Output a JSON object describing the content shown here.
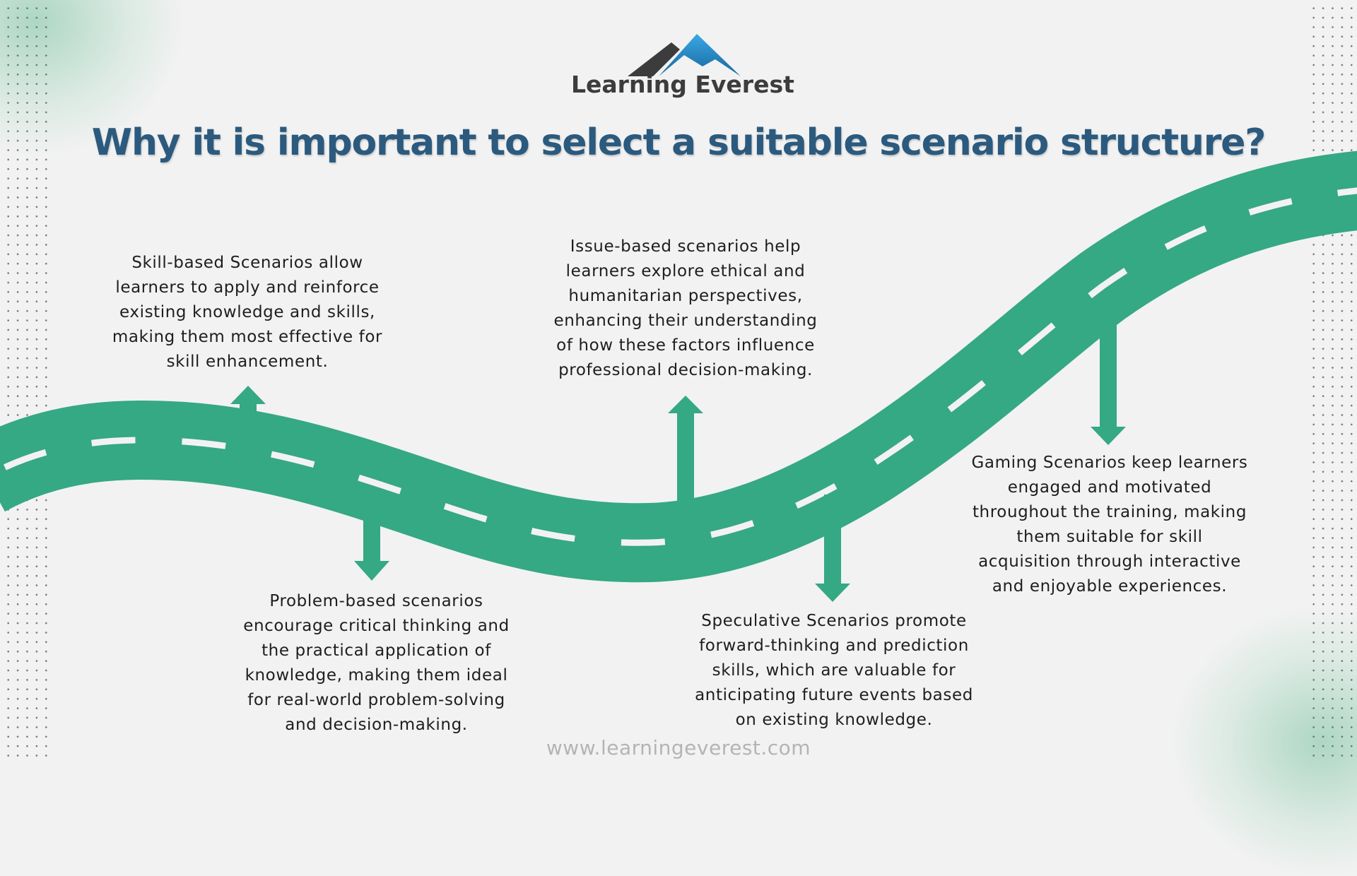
{
  "brand": {
    "name": "Learning Everest",
    "website": "www.learningeverest.com"
  },
  "title": "Why it is important to select a suitable scenario structure?",
  "colors": {
    "road": "#35a884",
    "title": "#2b5a7e",
    "body_text": "#1e1e1e",
    "logo_dark": "#3c3c3c",
    "logo_blue": "#1f8fd1",
    "footer": "#b4b4b4",
    "background": "#f2f2f2"
  },
  "scenarios": [
    {
      "id": "skill",
      "arrow_direction": "up",
      "lines": [
        "Skill-based Scenarios allow",
        "learners to apply and reinforce",
        "existing knowledge and skills,",
        "making them most effective for",
        "skill enhancement."
      ]
    },
    {
      "id": "problem",
      "arrow_direction": "down",
      "lines": [
        "Problem-based scenarios",
        "encourage critical thinking and",
        "the practical application of",
        "knowledge, making them ideal",
        "for real-world problem-solving",
        "and decision-making."
      ]
    },
    {
      "id": "issue",
      "arrow_direction": "up",
      "lines": [
        "Issue-based scenarios help",
        "learners explore ethical and",
        "humanitarian perspectives,",
        "enhancing their understanding",
        "of how these factors influence",
        "professional decision-making."
      ]
    },
    {
      "id": "speculative",
      "arrow_direction": "down",
      "lines": [
        "Speculative Scenarios promote",
        "forward-thinking and prediction",
        "skills, which are valuable for",
        "anticipating future events based",
        "on existing knowledge."
      ]
    },
    {
      "id": "gaming",
      "arrow_direction": "down",
      "lines": [
        "Gaming Scenarios keep learners",
        "engaged and motivated",
        "throughout the training, making",
        "them suitable for skill",
        "acquisition through interactive",
        "and enjoyable experiences."
      ]
    }
  ]
}
